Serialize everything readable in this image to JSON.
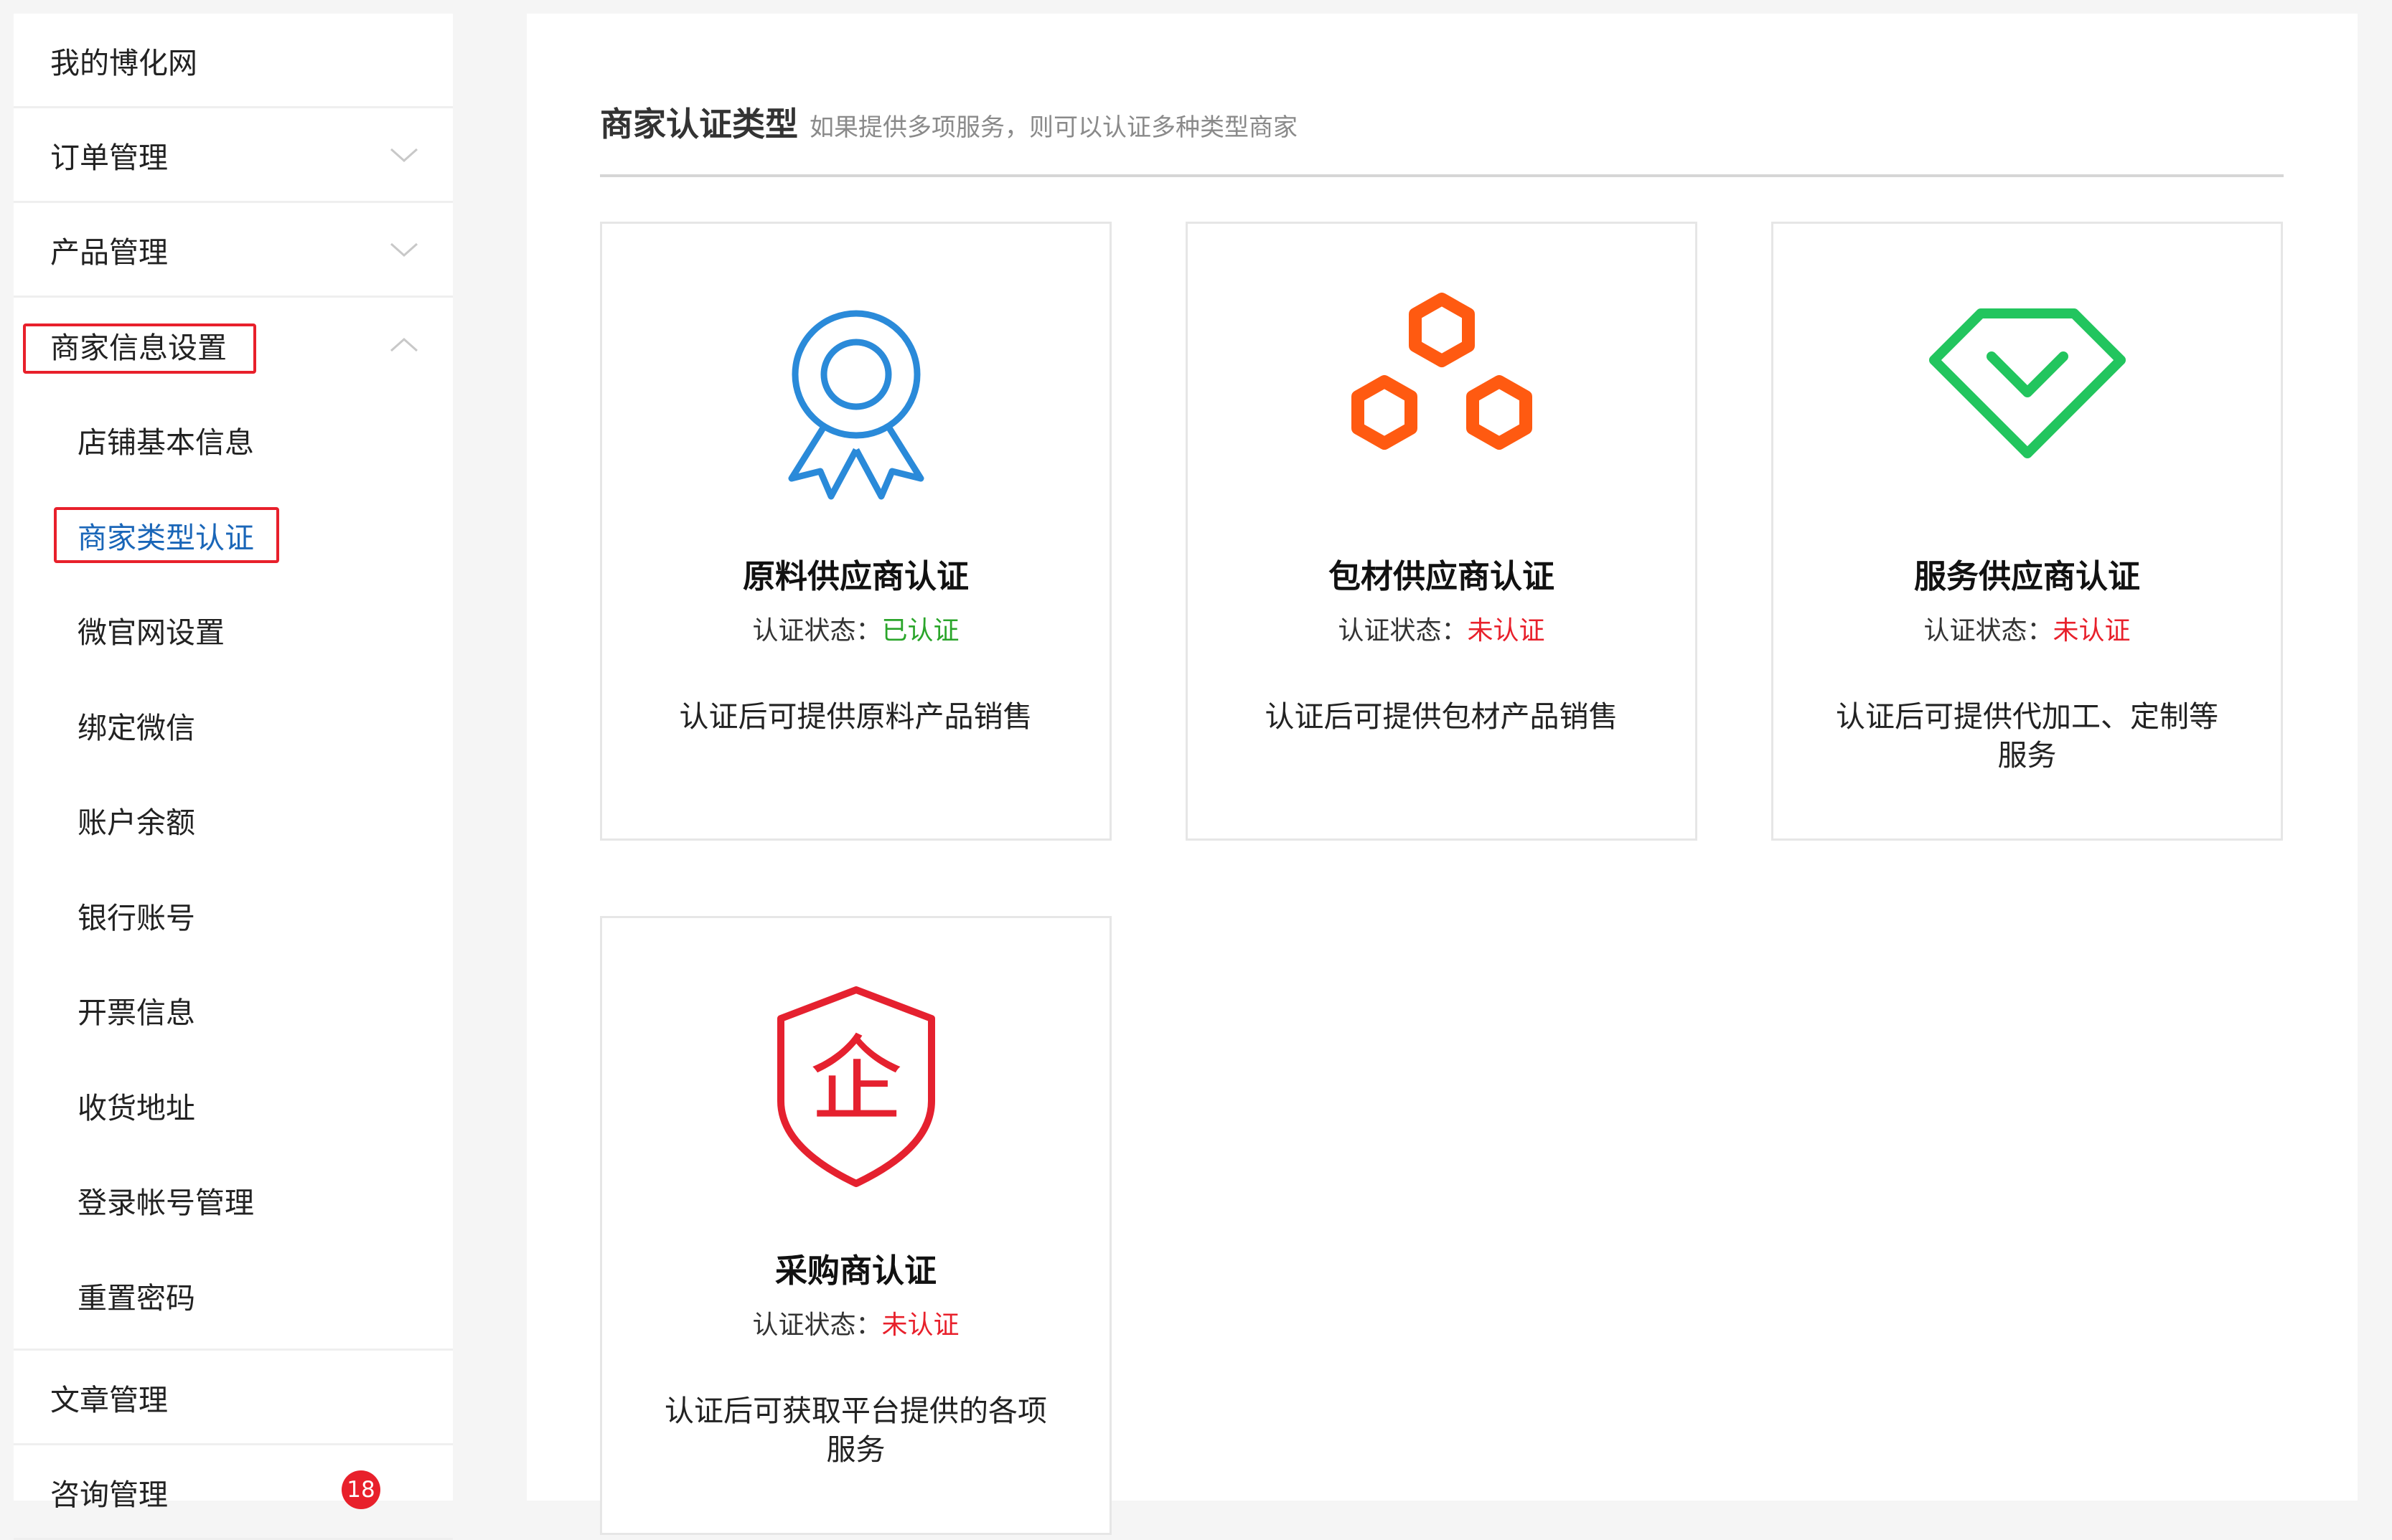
{
  "sidebar": {
    "items": [
      {
        "label": "我的博化网"
      },
      {
        "label": "订单管理"
      },
      {
        "label": "产品管理"
      },
      {
        "label": "商家信息设置"
      },
      {
        "label": "文章管理"
      },
      {
        "label": "咨询管理",
        "badge": "18"
      }
    ],
    "subitems": [
      {
        "label": "店铺基本信息"
      },
      {
        "label": "商家类型认证"
      },
      {
        "label": "微官网设置"
      },
      {
        "label": "绑定微信"
      },
      {
        "label": "账户余额"
      },
      {
        "label": "银行账号"
      },
      {
        "label": "开票信息"
      },
      {
        "label": "收货地址"
      },
      {
        "label": "登录帐号管理"
      },
      {
        "label": "重置密码"
      }
    ]
  },
  "main": {
    "title": "商家认证类型",
    "subtitle": "如果提供多项服务，则可以认证多种类型商家",
    "status_label": "认证状态：",
    "cards": [
      {
        "name": "原料供应商认证",
        "status": "已认证",
        "desc": "认证后可提供原料产品销售",
        "icon": "award-ribbon-icon",
        "color": "#2a8ad9",
        "status_color": "#2aa52a"
      },
      {
        "name": "包材供应商认证",
        "status": "未认证",
        "desc": "认证后可提供包材产品销售",
        "icon": "hexagons-icon",
        "color": "#ff5a11",
        "status_color": "#e8202b"
      },
      {
        "name": "服务供应商认证",
        "status": "未认证",
        "desc": "认证后可提供代加工、定制等服务",
        "icon": "diamond-check-icon",
        "color": "#22c55e",
        "status_color": "#e8202b"
      },
      {
        "name": "采购商认证",
        "status": "未认证",
        "desc": "认证后可获取平台提供的各项服务",
        "icon": "shield-enterprise-icon",
        "color": "#e5212f",
        "status_color": "#e8202b",
        "icon_text": "企"
      }
    ]
  }
}
